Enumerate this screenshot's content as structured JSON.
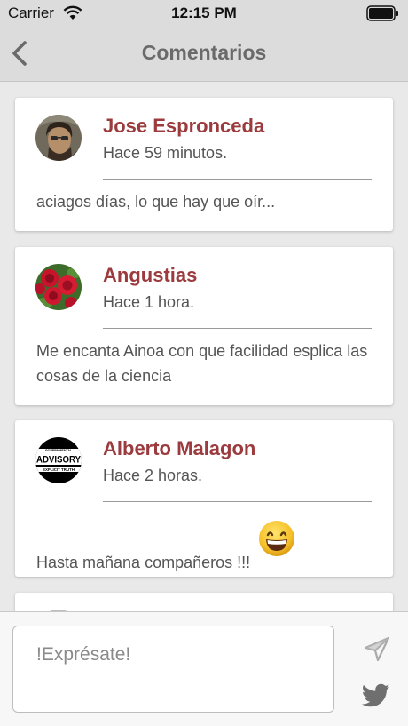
{
  "status_bar": {
    "carrier": "Carrier",
    "time": "12:15 PM"
  },
  "nav": {
    "title": "Comentarios",
    "back_icon": "chevron-left-icon"
  },
  "comments": [
    {
      "author": "Jose Espronceda",
      "time": "Hace 59 minutos.",
      "text": "aciagos días, lo que hay que oír...",
      "avatar": "portrait-avatar"
    },
    {
      "author": "Angustias",
      "time": "Hace 1 hora.",
      "text": "Me encanta Ainoa con que facilidad esplica las cosas de la ciencia",
      "avatar": "roses-avatar"
    },
    {
      "author": "Alberto Malagon",
      "time": "Hace 2 horas.",
      "text": "Hasta mañana compañeros !!!",
      "emoji": "grinning-face-emoji",
      "avatar": "advisory-logo-avatar"
    }
  ],
  "avatar_labels": {
    "top": "GOVERNMENTAL",
    "main": "ADVISORY",
    "bottom": "EXPLICIT TRUTH"
  },
  "composer": {
    "placeholder": "!Exprésate!",
    "send_icon": "send-icon",
    "twitter_icon": "twitter-icon"
  },
  "colors": {
    "author": "#9b3b3e",
    "nav_background": "#dcdcdc",
    "background": "#e9e9e9"
  }
}
